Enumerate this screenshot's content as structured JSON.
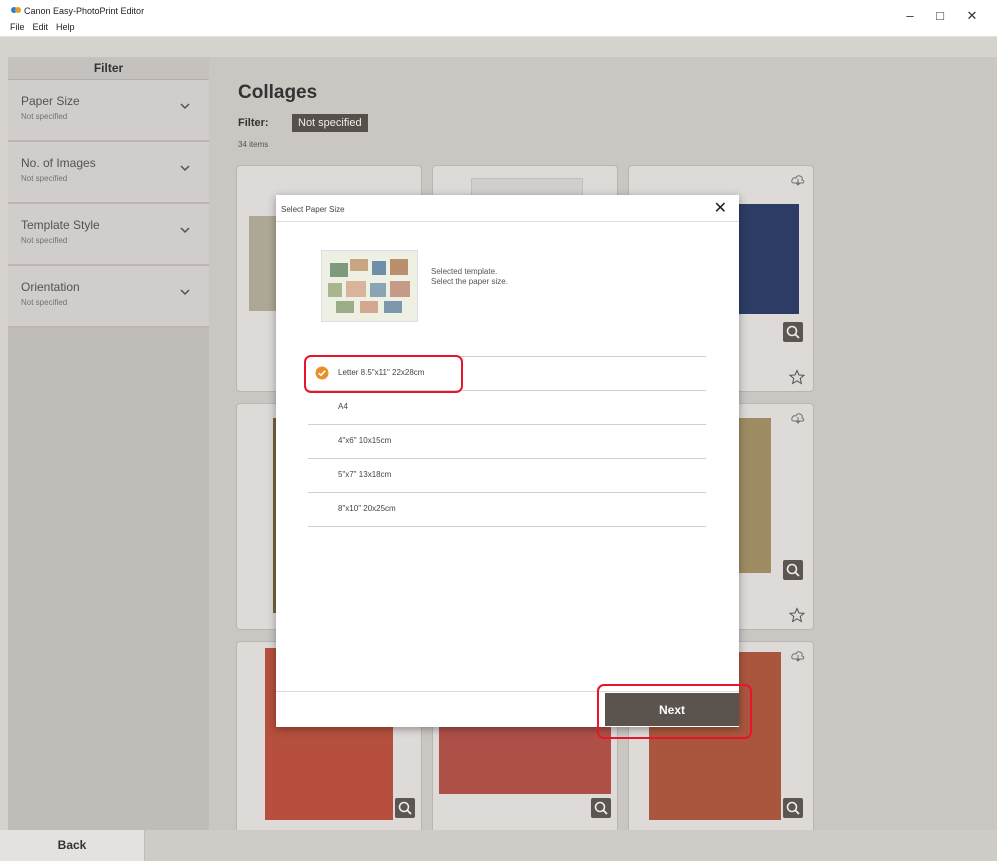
{
  "window": {
    "title": "Canon Easy-PhotoPrint Editor",
    "menu": [
      "File",
      "Edit",
      "Help"
    ],
    "controls": {
      "minimize": "–",
      "maximize": "□",
      "close": "✕"
    }
  },
  "sidebar": {
    "header": "Filter",
    "filters": [
      {
        "label": "Paper Size",
        "value": "Not specified"
      },
      {
        "label": "No. of Images",
        "value": "Not specified"
      },
      {
        "label": "Template Style",
        "value": "Not specified"
      },
      {
        "label": "Orientation",
        "value": "Not specified"
      }
    ]
  },
  "main": {
    "title": "Collages",
    "filter_label": "Filter:",
    "filter_value": "Not specified",
    "item_count": "34 items"
  },
  "dialog": {
    "title": "Select Paper Size",
    "close": "✕",
    "message_line1": "Selected template.",
    "message_line2": "Select the paper size.",
    "sizes": [
      {
        "label": "Letter 8.5\"x11\" 22x28cm",
        "selected": true
      },
      {
        "label": "A4",
        "selected": false
      },
      {
        "label": "4\"x6\" 10x15cm",
        "selected": false
      },
      {
        "label": "5\"x7\" 13x18cm",
        "selected": false
      },
      {
        "label": "8\"x10\" 20x25cm",
        "selected": false
      }
    ],
    "next_label": "Next"
  },
  "footer": {
    "back_label": "Back"
  },
  "colors": {
    "accent": "#e8902a",
    "highlight": "#e8152a",
    "button_dark": "#5b534d"
  }
}
